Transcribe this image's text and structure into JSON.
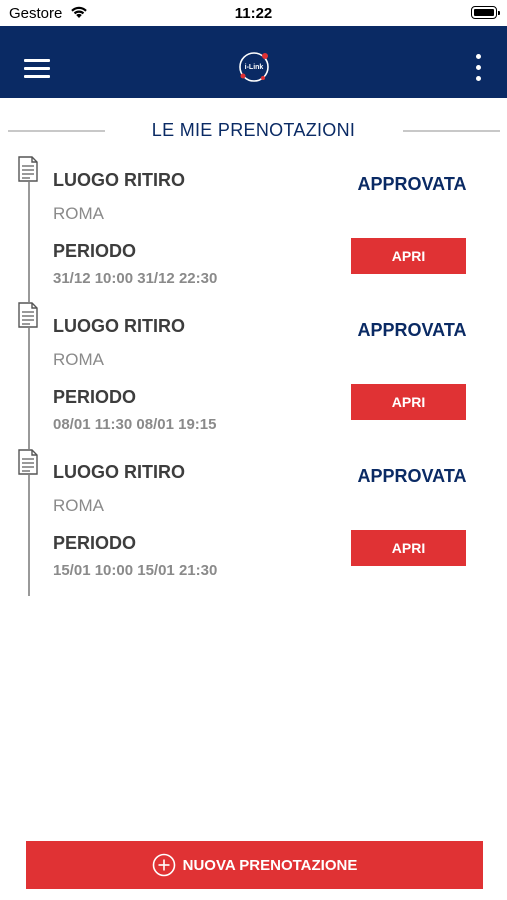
{
  "status_bar": {
    "carrier": "Gestore",
    "time": "11:22"
  },
  "header": {
    "logo_text": "i-Link",
    "menu_icon": "hamburger-icon",
    "more_icon": "more-vertical-icon"
  },
  "section": {
    "title": "LE MIE PRENOTAZIONI"
  },
  "bookings": [
    {
      "pickup_label": "LUOGO RITIRO",
      "pickup_value": "ROMA",
      "status": "APPROVATA",
      "period_label": "PERIODO",
      "period_value": "31/12 10:00 31/12 22:30",
      "action": "APRI"
    },
    {
      "pickup_label": "LUOGO RITIRO",
      "pickup_value": "ROMA",
      "status": "APPROVATA",
      "period_label": "PERIODO",
      "period_value": "08/01 11:30 08/01 19:15",
      "action": "APRI"
    },
    {
      "pickup_label": "LUOGO RITIRO",
      "pickup_value": "ROMA",
      "status": "APPROVATA",
      "period_label": "PERIODO",
      "period_value": "15/01 10:00 15/01 21:30",
      "action": "APRI"
    }
  ],
  "footer": {
    "new_booking_label": "NUOVA PRENOTAZIONE"
  },
  "colors": {
    "navy": "#0a2a64",
    "red": "#e03234",
    "gray_text": "#8a8a8a"
  }
}
